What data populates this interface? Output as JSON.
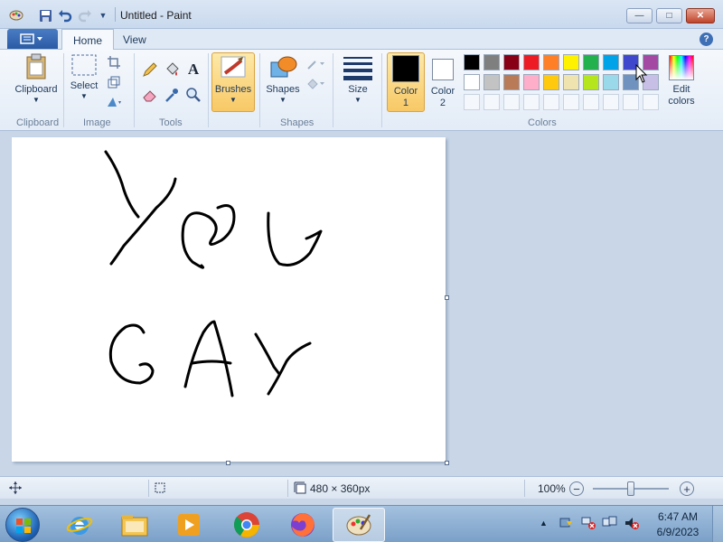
{
  "window": {
    "title": "Untitled - Paint",
    "minimize": "—",
    "maximize": "□",
    "close": "✕"
  },
  "tabs": {
    "home": "Home",
    "view": "View",
    "help": "?"
  },
  "ribbon": {
    "clipboard": {
      "button": "Clipboard",
      "group": "Clipboard"
    },
    "image": {
      "select": "Select",
      "group": "Image"
    },
    "tools": {
      "group": "Tools",
      "text_tool": "A"
    },
    "brushes": "Brushes",
    "shapes": {
      "button": "Shapes",
      "group": "Shapes"
    },
    "size": "Size",
    "color1": {
      "line1": "Color",
      "line2": "1",
      "value": "#000000"
    },
    "color2": {
      "line1": "Color",
      "line2": "2",
      "value": "#ffffff"
    },
    "colors_group": "Colors",
    "edit_colors": {
      "line1": "Edit",
      "line2": "colors"
    },
    "palette_row1": [
      "#000000",
      "#7f7f7f",
      "#880015",
      "#ed1c24",
      "#ff7f27",
      "#fff200",
      "#22b14c",
      "#00a2e8",
      "#3f48cc",
      "#a349a4"
    ],
    "palette_row2": [
      "#ffffff",
      "#c3c3c3",
      "#b97a57",
      "#ffaec9",
      "#ffc90e",
      "#efe4b0",
      "#b5e61d",
      "#99d9ea",
      "#7092be",
      "#c8bfe7"
    ],
    "palette_row3_empty": 10
  },
  "canvas": {
    "drawing_word1": "YOU",
    "drawing_word2": "GAY"
  },
  "statusbar": {
    "image_size": "480 × 360px",
    "zoom": "100%",
    "zoom_out": "−",
    "zoom_in": "+",
    "zoom_level": 0.5
  },
  "taskbar": {
    "apps": [
      "start",
      "internet-explorer",
      "file-explorer",
      "media-player",
      "chrome",
      "firefox",
      "paint"
    ],
    "time": "6:47 AM",
    "date": "6/9/2023",
    "tray_expand": "▲"
  }
}
